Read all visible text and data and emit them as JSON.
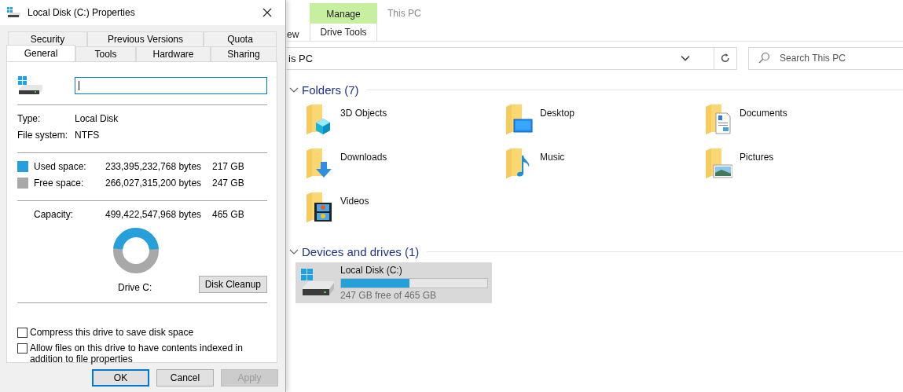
{
  "explorer": {
    "ribbon": {
      "partial_tab": "ew",
      "context_group": "Manage",
      "context_tab": "Drive Tools",
      "window_title": "This PC"
    },
    "address": "is PC",
    "search": {
      "placeholder": "Search This PC"
    },
    "folders": {
      "title": "Folders (7)",
      "expanded": true,
      "items": [
        {
          "name": "3D Objects"
        },
        {
          "name": "Desktop"
        },
        {
          "name": "Documents"
        },
        {
          "name": "Downloads"
        },
        {
          "name": "Music"
        },
        {
          "name": "Pictures"
        },
        {
          "name": "Videos"
        }
      ]
    },
    "devices": {
      "title": "Devices and drives (1)",
      "expanded": true,
      "items": [
        {
          "name": "Local Disk (C:)",
          "level": 0.47,
          "free": "247 GB free of 465 GB",
          "selected": true
        }
      ]
    }
  },
  "dialog": {
    "title": "Local Disk (C:) Properties",
    "tabs_back": [
      {
        "label": "Security",
        "selected": false
      },
      {
        "label": "Previous Versions",
        "selected": false
      },
      {
        "label": "Quota",
        "selected": false
      }
    ],
    "tabs_front": [
      {
        "label": "General",
        "selected": true
      },
      {
        "label": "Tools",
        "selected": false
      },
      {
        "label": "Hardware",
        "selected": false
      },
      {
        "label": "Sharing",
        "selected": false
      }
    ],
    "info": [
      {
        "label": "Type:",
        "value": "Local Disk"
      },
      {
        "label": "File system:",
        "value": "NTFS"
      }
    ],
    "space": [
      {
        "label": "Used space:",
        "bytes": "233,395,232,768 bytes",
        "size": "217 GB",
        "color": "#26a0da"
      },
      {
        "label": "Free space:",
        "bytes": "266,027,315,200 bytes",
        "size": "247 GB",
        "color": "#a8a8a8"
      }
    ],
    "capacity": {
      "label": "Capacity:",
      "bytes": "499,422,547,968 bytes",
      "size": "465 GB"
    },
    "usage_ring": {
      "level": 0.47
    },
    "drive_label": "Drive C:",
    "cleanup_button": "Disk Cleanup",
    "options": [
      {
        "label": "Compress this drive to save disk space",
        "checked": false
      },
      {
        "label": "Allow files on this drive to have contents indexed in addition to file properties",
        "checked": false
      }
    ],
    "buttons": [
      {
        "label": "OK",
        "default": true,
        "disabled": false
      },
      {
        "label": "Cancel",
        "default": false,
        "disabled": false
      },
      {
        "label": "Apply",
        "default": false,
        "disabled": true
      }
    ]
  }
}
